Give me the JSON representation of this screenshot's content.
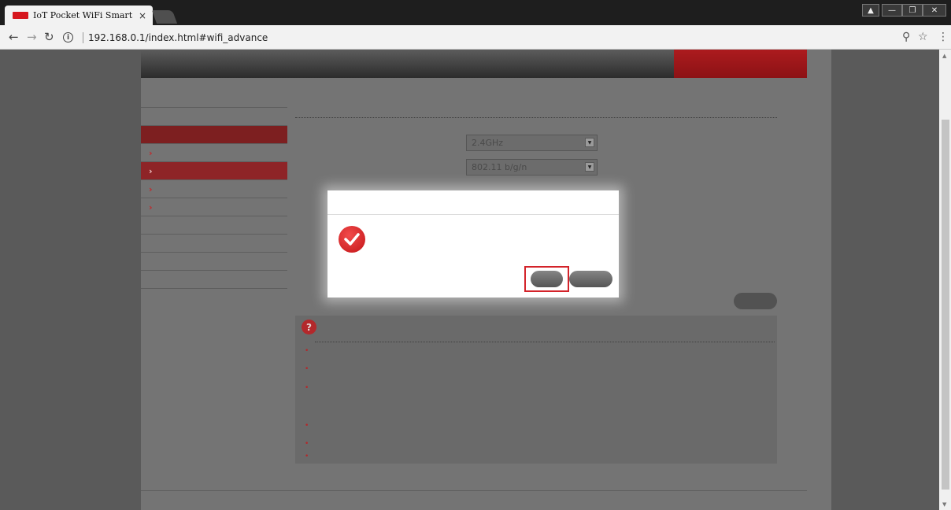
{
  "browser": {
    "tab_title": "IoT Pocket WiFi Smart I",
    "tab_close": "×",
    "security_text": "",
    "url": "192.168.0.1/index.html#wifi_advance"
  },
  "nav": {
    "items": [
      "",
      "",
      "",
      "",
      ""
    ],
    "active_index": 4
  },
  "sidebar": {
    "quick_setup": "",
    "network_settings": "",
    "wifi_settings": "",
    "wifi_basic": "",
    "wifi_advanced": "",
    "accounts": "",
    "wps": "",
    "device_settings": "",
    "firewall": "",
    "router_settings": "",
    "internet_wifi": ""
  },
  "main": {
    "heading": "",
    "band_label": "",
    "band_value": "2.4GHz",
    "mode_label": "",
    "mode_value": "802.11 b/g/n",
    "ok_button": ""
  },
  "help": {
    "icon": "?",
    "items": [
      "",
      "",
      "",
      "",
      "",
      "",
      ""
    ]
  },
  "footer": {
    "copyright": "",
    "divider": "",
    "license_link": ""
  },
  "dialog": {
    "title": "",
    "message_line1": "",
    "message_line2": "",
    "yes_button": "",
    "no_button": ""
  },
  "colors": {
    "brand_red": "#c31417",
    "nav_active": "#9e171a",
    "highlight_box": "#d3232a"
  },
  "icons": [
    "info-icon",
    "back-icon",
    "forward-icon",
    "reload-icon",
    "key-icon",
    "star-icon",
    "menu-icon",
    "help-icon",
    "check-icon",
    "chevron-down-icon"
  ]
}
